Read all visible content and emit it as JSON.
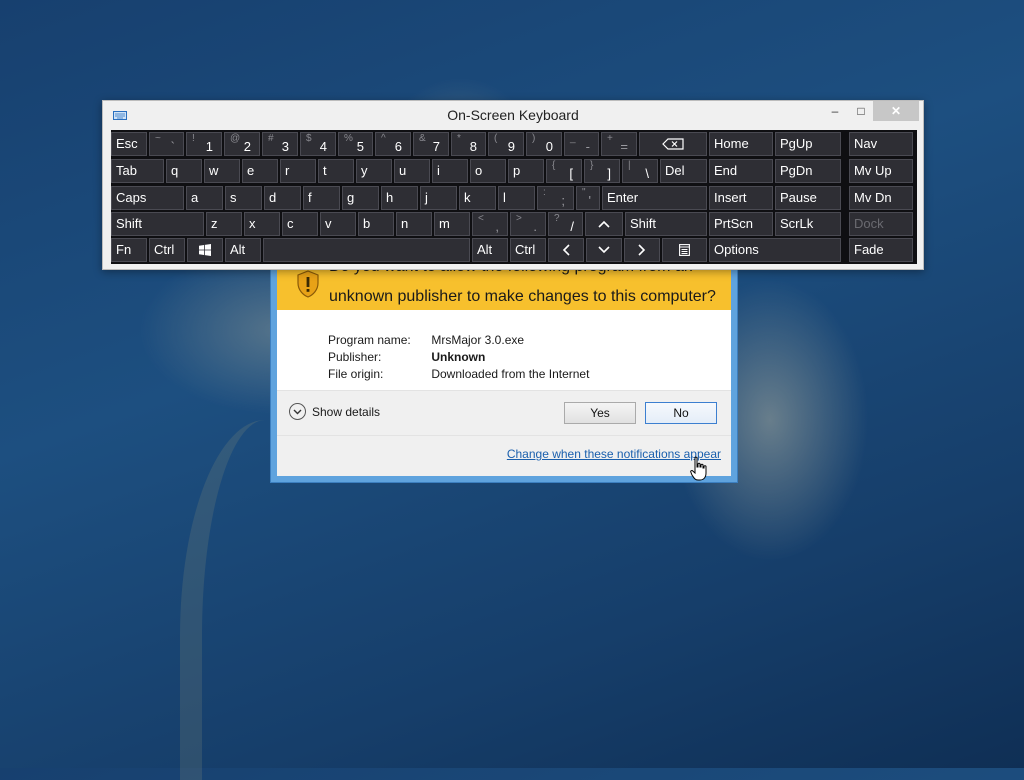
{
  "osk": {
    "title": "On-Screen Keyboard",
    "window_buttons": {
      "minimize": "–",
      "maximize": "□",
      "close": "✕"
    },
    "rows": [
      [
        {
          "label": "Esc"
        },
        {
          "sub": "~",
          "label": "`",
          "dim": true
        },
        {
          "sub": "!",
          "label": "1"
        },
        {
          "sub": "@",
          "label": "2"
        },
        {
          "sub": "#",
          "label": "3"
        },
        {
          "sub": "$",
          "label": "4"
        },
        {
          "sub": "%",
          "label": "5"
        },
        {
          "sub": "^",
          "label": "6"
        },
        {
          "sub": "&",
          "label": "7"
        },
        {
          "sub": "*",
          "label": "8"
        },
        {
          "sub": "(",
          "label": "9"
        },
        {
          "sub": ")",
          "label": "0"
        },
        {
          "sub": "_",
          "label": "-",
          "dim": true
        },
        {
          "sub": "+",
          "label": "=",
          "dim": true
        },
        {
          "icon": "backspace-icon"
        }
      ],
      [
        {
          "label": "Tab"
        },
        {
          "label": "q"
        },
        {
          "label": "w"
        },
        {
          "label": "e"
        },
        {
          "label": "r"
        },
        {
          "label": "t"
        },
        {
          "label": "y"
        },
        {
          "label": "u"
        },
        {
          "label": "i"
        },
        {
          "label": "o"
        },
        {
          "label": "p"
        },
        {
          "sub": "{",
          "label": "["
        },
        {
          "sub": "}",
          "label": "]"
        },
        {
          "sub": "|",
          "label": "\\"
        },
        {
          "label": "Del"
        }
      ],
      [
        {
          "label": "Caps"
        },
        {
          "label": "a"
        },
        {
          "label": "s"
        },
        {
          "label": "d"
        },
        {
          "label": "f"
        },
        {
          "label": "g"
        },
        {
          "label": "h"
        },
        {
          "label": "j"
        },
        {
          "label": "k"
        },
        {
          "label": "l"
        },
        {
          "sub": ":",
          "label": ";",
          "dim": true
        },
        {
          "sub": "\"",
          "label": "'",
          "dim": true
        },
        {
          "label": "Enter"
        }
      ],
      [
        {
          "label": "Shift"
        },
        {
          "label": "z"
        },
        {
          "label": "x"
        },
        {
          "label": "c"
        },
        {
          "label": "v"
        },
        {
          "label": "b"
        },
        {
          "label": "n"
        },
        {
          "label": "m"
        },
        {
          "sub": "<",
          "label": ",",
          "dim": true
        },
        {
          "sub": ">",
          "label": ".",
          "dim": true
        },
        {
          "sub": "?",
          "label": "/"
        },
        {
          "icon": "up-arrow-icon"
        },
        {
          "label": "Shift"
        }
      ],
      [
        {
          "label": "Fn"
        },
        {
          "label": "Ctrl"
        },
        {
          "icon": "windows-icon"
        },
        {
          "label": "Alt"
        },
        {
          "label": ""
        },
        {
          "label": "Alt"
        },
        {
          "label": "Ctrl"
        },
        {
          "icon": "left-arrow-icon"
        },
        {
          "icon": "down-arrow-icon"
        },
        {
          "icon": "right-arrow-icon"
        },
        {
          "icon": "context-menu-icon"
        }
      ]
    ],
    "nav_keys": [
      [
        "Home",
        "PgUp"
      ],
      [
        "End",
        "PgDn"
      ],
      [
        "Insert",
        "Pause"
      ],
      [
        "PrtScn",
        "ScrLk"
      ],
      [
        "Options"
      ]
    ],
    "side_keys": [
      {
        "label": "Nav"
      },
      {
        "label": "Mv Up"
      },
      {
        "label": "Mv Dn"
      },
      {
        "label": "Dock",
        "disabled": true
      },
      {
        "label": "Fade"
      }
    ]
  },
  "uac": {
    "question_line1": "Do you want to allow the following program from an",
    "question_line2": "unknown publisher to make changes to this computer?",
    "program_name_label": "Program name:",
    "program_name_value": "MrsMajor 3.0.exe",
    "publisher_label": "Publisher:",
    "publisher_value": "Unknown",
    "file_origin_label": "File origin:",
    "file_origin_value": "Downloaded from the Internet",
    "show_details": "Show details",
    "yes_label": "Yes",
    "no_label": "No",
    "settings_link": "Change when these notifications appear",
    "banner_color": "#f7c02d",
    "frame_color": "#5fa3de"
  }
}
